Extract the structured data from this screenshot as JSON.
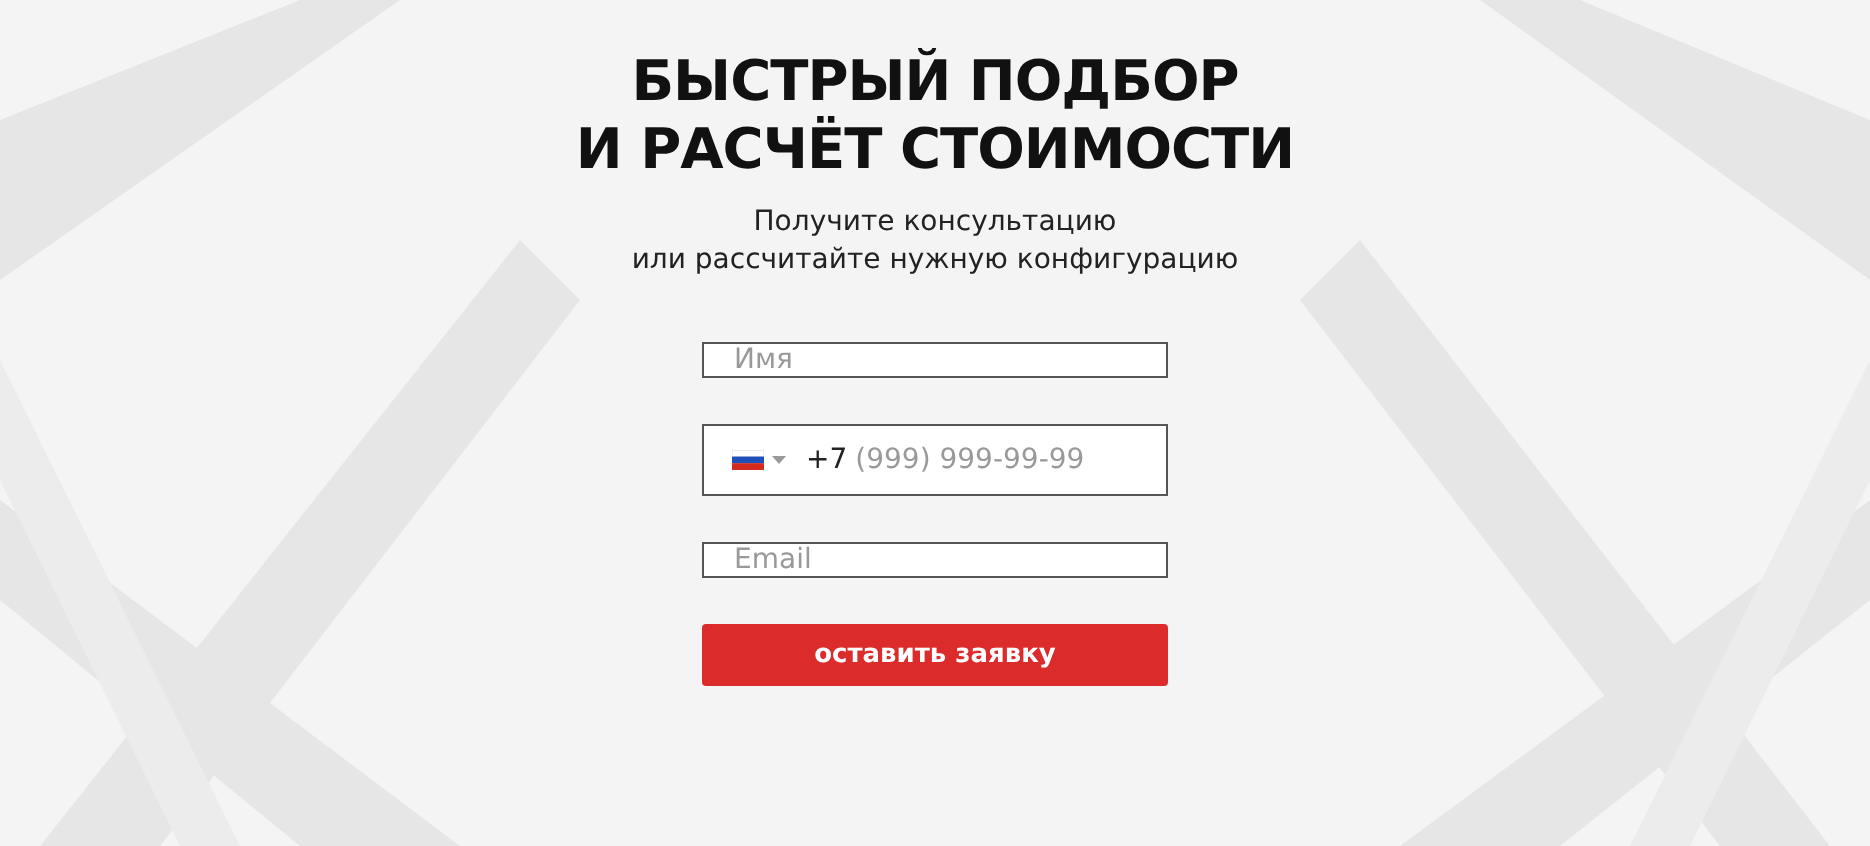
{
  "heading": {
    "title_lines": [
      "БЫСТРЫЙ ПОДБОР",
      "И РАСЧЁТ СТОИМОСТИ"
    ],
    "subtitle_lines": [
      "Получите консультацию",
      "или рассчитайте нужную конфигурацию"
    ]
  },
  "form": {
    "fields": [
      {
        "kind": "text",
        "placeholder": "Имя"
      },
      {
        "kind": "phone",
        "prefix": "+7",
        "placeholder": "(999) 999-99-99"
      },
      {
        "kind": "email",
        "placeholder": "Email"
      }
    ],
    "submit": "оставить заявку"
  }
}
